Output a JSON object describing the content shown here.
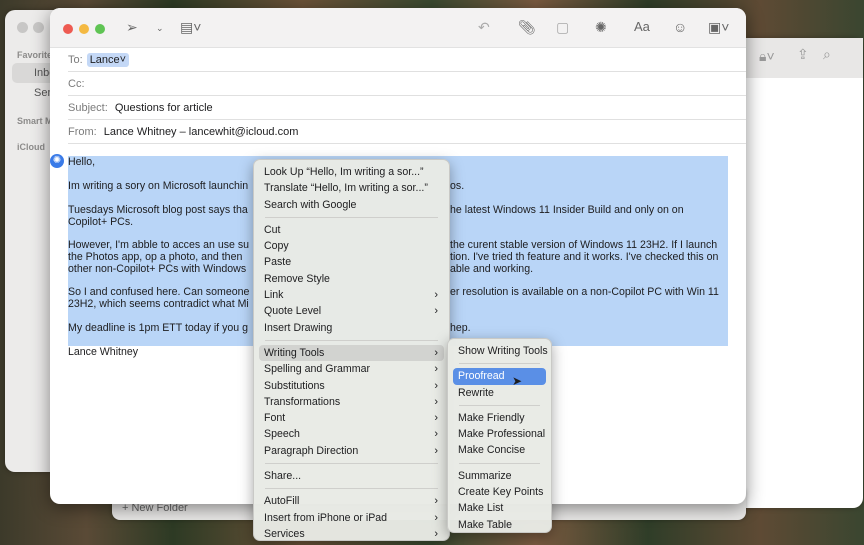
{
  "sidebar": {
    "favorites": "Favorites",
    "inbox": "Inbox",
    "sent": "Sent",
    "smart": "Smart Mailboxes",
    "icloud": "iCloud",
    "new_folder": "New Folder"
  },
  "compose": {
    "to_label": "To:",
    "to_value": "Lance",
    "cc_label": "Cc:",
    "subject_label": "Subject:",
    "subject_value": "Questions for article",
    "from_label": "From:",
    "from_value": "Lance Whitney – lancewhit@icloud.com",
    "body_lines": [
      {
        "left": "Hello,",
        "right": ""
      },
      {
        "left": "Im writing a sory on Microsoft launchin",
        "right": "os."
      },
      {
        "left": "Tuesdays Microsoft blog post says tha",
        "right": "he latest Windows 11 Insider Build and only on on"
      },
      {
        "left": "Copilot+ PCs.",
        "right": ""
      },
      {
        "left": "However, I'm abble to acces an use su",
        "right": "the curent stable version of Windows 11 23H2. If I launch"
      },
      {
        "left": "the Photos app,  op a photo, and then",
        "right": "tion. I've tried th feature and it works. I've checked this on"
      },
      {
        "left": "other non-Copilot+ PCs with Windows",
        "right": "able and working."
      },
      {
        "left": "So I and confused here. Can someone",
        "right": "er resolution is available on a non-Copilot PC with Win 11"
      },
      {
        "left": "23H2, which seems contradict what Mi",
        "right": ""
      },
      {
        "left": "My deadline is 1pm ETT today if you g",
        "right": "hep."
      },
      {
        "left": "Lance Whitney",
        "right": ""
      }
    ]
  },
  "toolbar": {
    "font_label": "Aa"
  },
  "context_menu": {
    "items": [
      "Look Up “Hello,  Im writing a sor...”",
      "Translate “Hello,  Im writing a sor...”",
      "Search with Google",
      "Cut",
      "Copy",
      "Paste",
      "Remove Style",
      "Link",
      "Quote Level",
      "Insert Drawing",
      "Writing Tools",
      "Spelling and Grammar",
      "Substitutions",
      "Transformations",
      "Font",
      "Speech",
      "Paragraph Direction",
      "Share...",
      "AutoFill",
      "Insert from iPhone or iPad",
      "Services"
    ]
  },
  "writing_tools_menu": {
    "items": [
      "Show Writing Tools",
      "Proofread",
      "Rewrite",
      "Make Friendly",
      "Make Professional",
      "Make Concise",
      "Summarize",
      "Create Key Points",
      "Make List",
      "Make Table"
    ]
  }
}
